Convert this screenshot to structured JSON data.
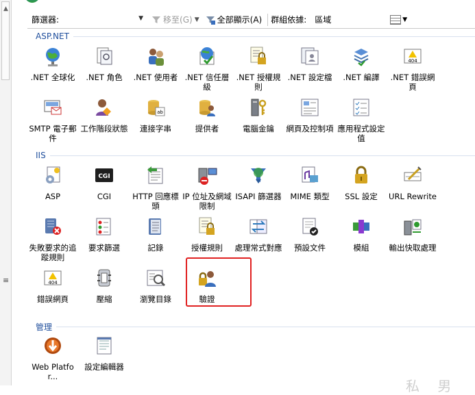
{
  "toolbar": {
    "filter_label": "篩選器:",
    "filter_value": "",
    "go_label": "移至(G)",
    "show_all_label": "全部顯示(A)",
    "group_by_label": "群組依據:",
    "group_by_value": "區域"
  },
  "sections": [
    {
      "title": "ASP.NET",
      "items": [
        {
          "label": ".NET 全球化",
          "icon": "globe-icon"
        },
        {
          "label": ".NET 角色",
          "icon": "document-roles-icon"
        },
        {
          "label": ".NET 使用者",
          "icon": "users-icon"
        },
        {
          "label": ".NET 信任層級",
          "icon": "trust-level-icon"
        },
        {
          "label": ".NET 授權規則",
          "icon": "authorization-lock-icon"
        },
        {
          "label": ".NET 設定檔",
          "icon": "profile-document-icon"
        },
        {
          "label": ".NET 編譯",
          "icon": "compilation-stack-icon"
        },
        {
          "label": ".NET 錯誤網頁",
          "icon": "error-page-404-icon"
        },
        {
          "label": "SMTP 電子郵件",
          "icon": "smtp-mail-icon"
        },
        {
          "label": "工作階段狀態",
          "icon": "session-user-icon"
        },
        {
          "label": "連接字串",
          "icon": "connection-string-icon"
        },
        {
          "label": "提供者",
          "icon": "provider-icon"
        },
        {
          "label": "電腦金鑰",
          "icon": "machine-key-icon"
        },
        {
          "label": "網頁及控制項",
          "icon": "pages-controls-icon"
        },
        {
          "label": "應用程式設定值",
          "icon": "app-settings-icon"
        }
      ]
    },
    {
      "title": "IIS",
      "items": [
        {
          "label": "ASP",
          "icon": "asp-icon"
        },
        {
          "label": "CGI",
          "icon": "cgi-icon"
        },
        {
          "label": "HTTP 回應標頭",
          "icon": "http-headers-icon"
        },
        {
          "label": "IP 位址及網域限制",
          "icon": "ip-restriction-icon"
        },
        {
          "label": "ISAPI 篩選器",
          "icon": "isapi-filter-icon"
        },
        {
          "label": "MIME 類型",
          "icon": "mime-type-icon"
        },
        {
          "label": "SSL 設定",
          "icon": "ssl-lock-icon"
        },
        {
          "label": "URL Rewrite",
          "icon": "url-rewrite-icon"
        },
        {
          "label": "失敗要求的追蹤規則",
          "icon": "failed-request-icon"
        },
        {
          "label": "要求篩選",
          "icon": "request-filter-icon"
        },
        {
          "label": "記錄",
          "icon": "logging-icon"
        },
        {
          "label": "授權規則",
          "icon": "authorization-rules-icon"
        },
        {
          "label": "處理常式對應",
          "icon": "handler-mappings-icon"
        },
        {
          "label": "預設文件",
          "icon": "default-document-icon"
        },
        {
          "label": "模組",
          "icon": "modules-icon"
        },
        {
          "label": "輸出快取處理",
          "icon": "output-cache-icon"
        },
        {
          "label": "錯誤網頁",
          "icon": "error-pages-icon"
        },
        {
          "label": "壓縮",
          "icon": "compression-icon"
        },
        {
          "label": "瀏覽目錄",
          "icon": "directory-browsing-icon"
        },
        {
          "label": "驗證",
          "icon": "authentication-icon"
        }
      ]
    },
    {
      "title": "管理",
      "items": [
        {
          "label": "Web Platfor...",
          "icon": "web-platform-icon"
        },
        {
          "label": "設定編輯器",
          "icon": "configuration-editor-icon"
        }
      ]
    }
  ],
  "colors": {
    "section_title": "#1f4e9c",
    "highlight_border": "#e02020"
  }
}
